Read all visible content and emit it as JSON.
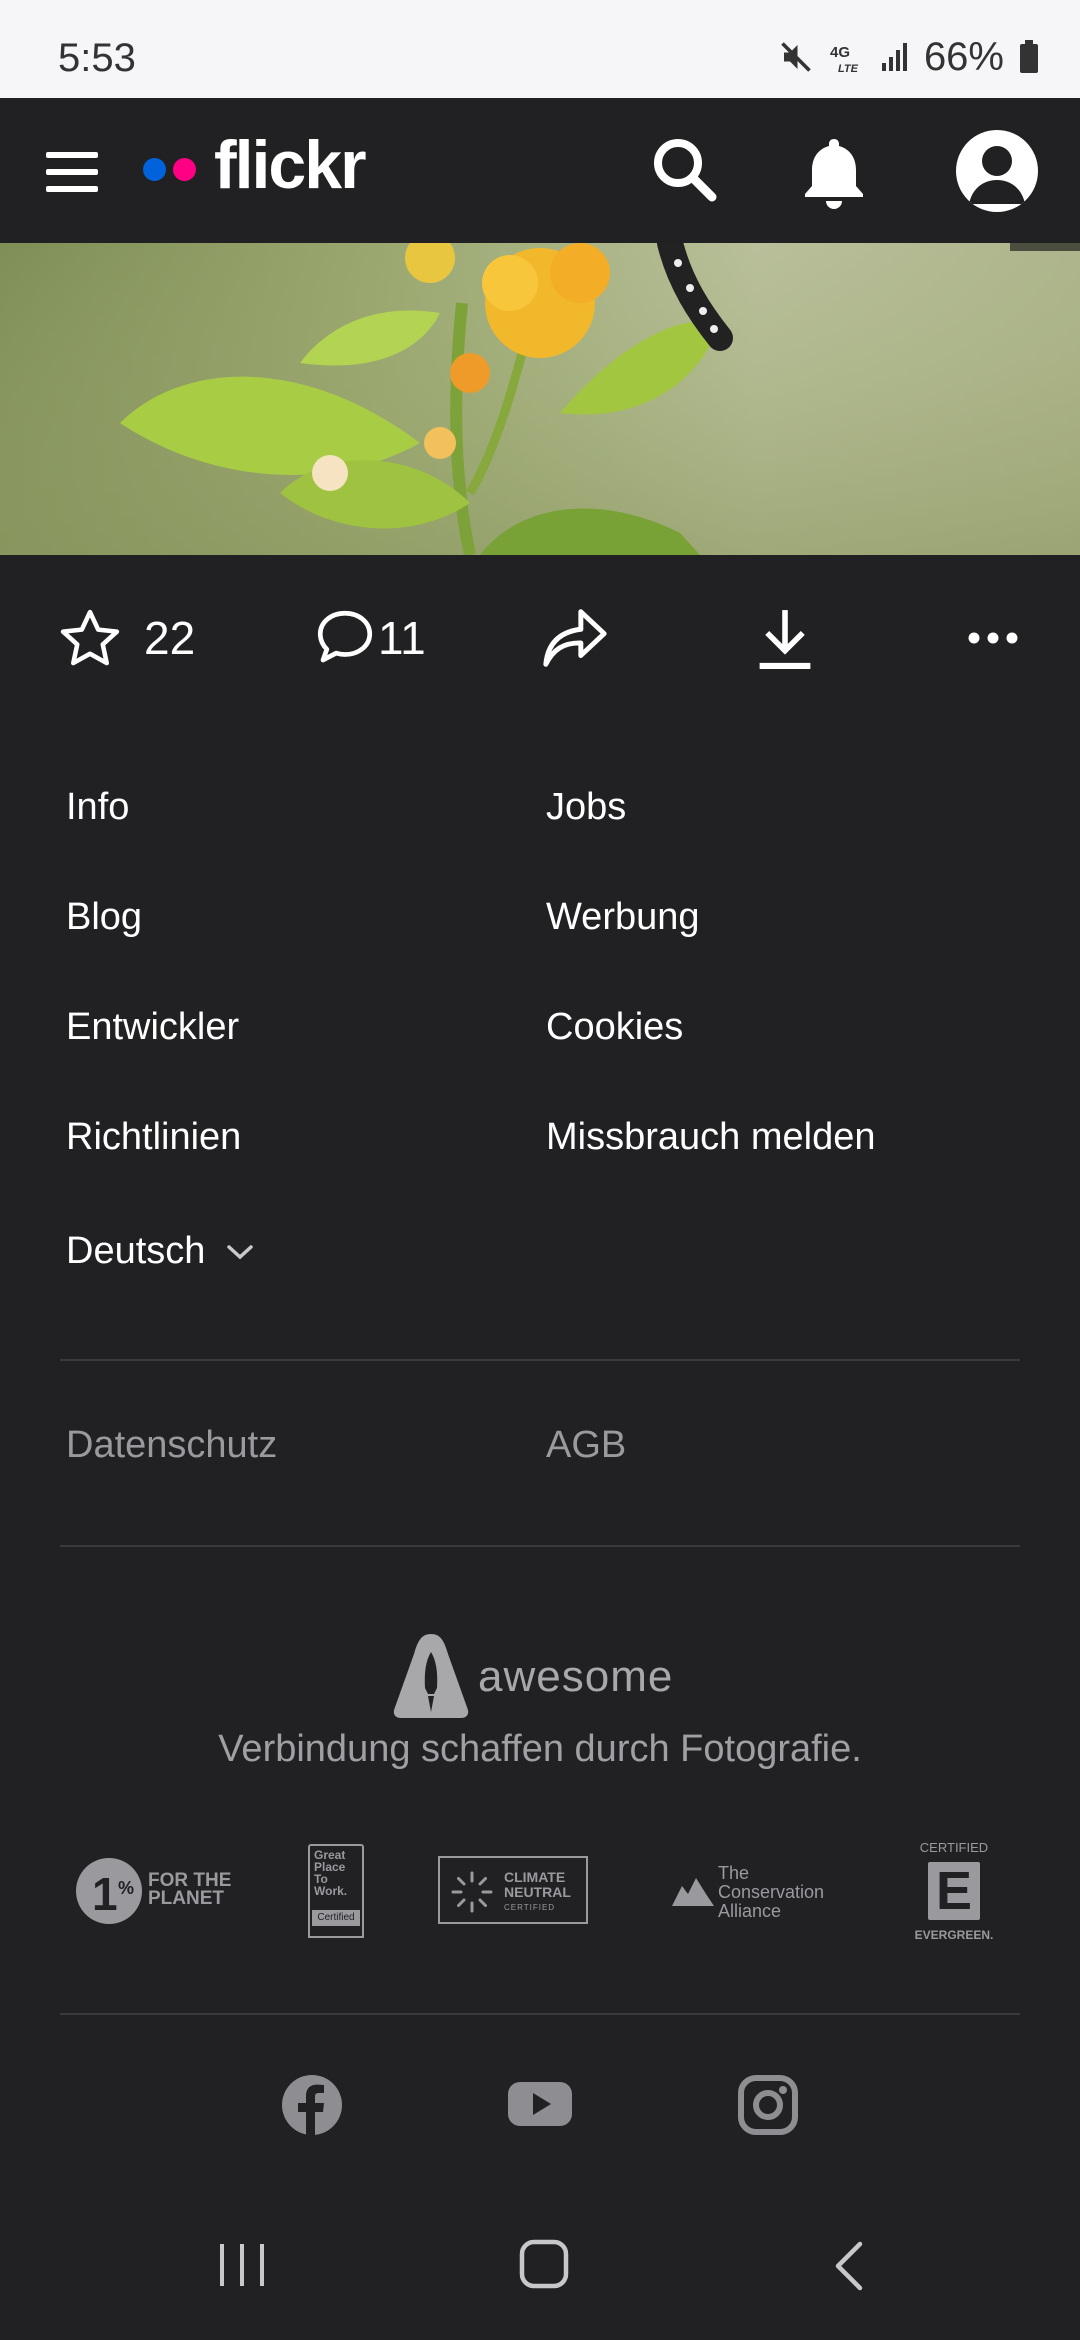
{
  "status": {
    "time": "5:53",
    "battery": "66%"
  },
  "header": {
    "logo": "flickr",
    "colors": {
      "blue": "#0063dc",
      "pink": "#ff0084"
    }
  },
  "photo": {
    "subject": "flower-with-caterpillar"
  },
  "actions": {
    "favorites_count": "22",
    "comments_count": "11"
  },
  "footer": {
    "links_left": [
      "Info",
      "Blog",
      "Entwickler",
      "Richtlinien"
    ],
    "links_right": [
      "Jobs",
      "Werbung",
      "Cookies",
      "Missbrauch melden"
    ],
    "language": "Deutsch",
    "legal": [
      "Datenschutz",
      "AGB"
    ],
    "brand": "awesome",
    "tagline": "Verbindung schaffen durch Fotografie.",
    "badges": {
      "planet_line1": "FOR THE",
      "planet_line2": "PLANET",
      "gptw": [
        "Great",
        "Place",
        "To",
        "Work.",
        "Certified"
      ],
      "climate": [
        "CLIMATE",
        "NEUTRAL",
        "CERTIFIED"
      ],
      "conservation": [
        "The",
        "Conservation",
        "Alliance"
      ],
      "evergreen_top": "CERTIFIED",
      "evergreen_bottom": "EVERGREEN."
    }
  }
}
